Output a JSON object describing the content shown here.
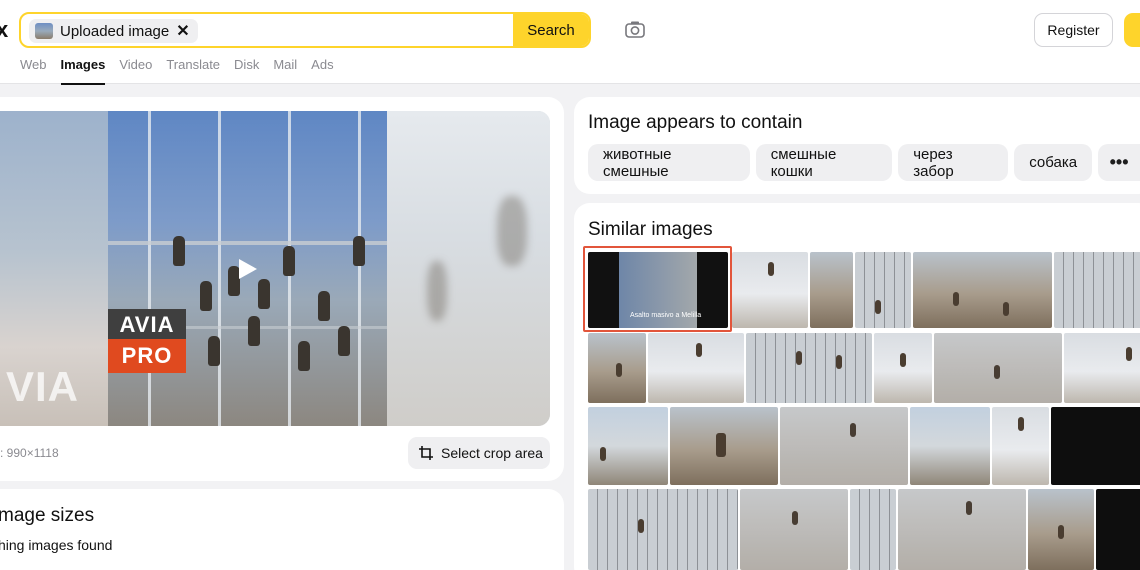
{
  "header": {
    "logo_fragment": "x",
    "search": {
      "chip_label": "Uploaded image",
      "chip_close": "✕",
      "button_label": "Search"
    },
    "register_label": "Register",
    "tabs": [
      {
        "label": "Web"
      },
      {
        "label": "Images",
        "active": true
      },
      {
        "label": "Video"
      },
      {
        "label": "Translate"
      },
      {
        "label": "Disk"
      },
      {
        "label": "Mail"
      },
      {
        "label": "Ads"
      }
    ]
  },
  "preview": {
    "overlay_top": "AVIA",
    "overlay_bottom": "PRO",
    "blurred_text": "VIA",
    "dimensions": ": 990×1118",
    "crop_button": "Select crop area"
  },
  "sizes": {
    "title": "mage sizes",
    "subtitle": "hing images found"
  },
  "contains": {
    "title": "Image appears to contain",
    "tags": [
      "животные смешные",
      "смешные кошки",
      "через забор",
      "собака"
    ],
    "more": "•••"
  },
  "similar": {
    "title": "Similar images",
    "first_caption": "Asalto masivo a Melilla"
  },
  "colors": {
    "accent_yellow": "#fed42b",
    "highlight_red": "#e2553b",
    "overlay_orange": "#e04a1f"
  }
}
